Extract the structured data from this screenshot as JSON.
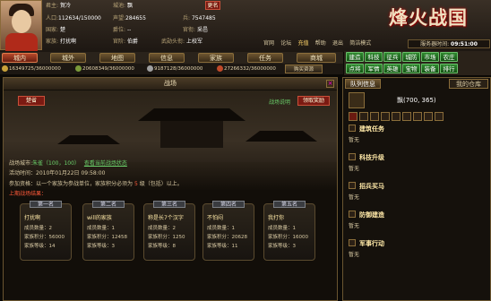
{
  "player": {
    "lord_label": "君主:",
    "lord_name": "賀冷",
    "city_label": "城池:",
    "city_name": "飘",
    "rename_button": "更名",
    "population_label": "人口:",
    "population": "112634/150000",
    "prestige_label": "声望:",
    "prestige": "284655",
    "official_label": "兵:",
    "official": "7547485",
    "country_label": "国家:",
    "country": "楚",
    "rank_label": "爵位:",
    "rank": "--",
    "level_label": "官衔:",
    "level": "采邑",
    "family_label": "家族:",
    "family": "打扰啊",
    "office_label": "官阶:",
    "office": "伯爵",
    "arms_label": "武勋头衔:",
    "arms": "上校军"
  },
  "game_logo": "烽火战国",
  "top_links": [
    "官网",
    "论坛",
    "充值",
    "帮助",
    "退出",
    "简洁模式"
  ],
  "server_time": {
    "label": "服务器时间:",
    "value": "09:51:00"
  },
  "nav_tabs": [
    "城内",
    "城外",
    "地图",
    "信息",
    "家族",
    "任务",
    "商城"
  ],
  "resources": [
    {
      "value": "16349725/36000000",
      "color": "#c9a23a"
    },
    {
      "value": "20608349/36000000",
      "color": "#7a9a3a"
    },
    {
      "value": "9187128/36000000",
      "color": "#a0a0a0"
    },
    {
      "value": "27266332/36000000",
      "color": "#c04a2a"
    }
  ],
  "buy_resources": "购买资源",
  "menu_row1": [
    "建造",
    "科技",
    "征兵",
    "城防",
    "市场",
    "农庄"
  ],
  "menu_row2": [
    "点将",
    "军情",
    "英雄",
    "宝物",
    "装备",
    "排行"
  ],
  "battle": {
    "panel_title": "战场",
    "country_badge": "楚省",
    "battle_help": "战场说明",
    "claim_button": "领取奖励",
    "city_label": "战场城市:",
    "city_value": "朱雀（100，100）",
    "city_link": "查看当前战场状态",
    "time_label": "活动时间：",
    "time_value": "2010年01月22日 09:58:00",
    "qualify_label": "参加资格：",
    "qualify_value": "以一个家族为参战单位，家族积分必须为",
    "qualify_num": "5",
    "qualify_tail": "级（包括）以上。",
    "result_title": "上期战场结果：",
    "cards": [
      {
        "rank": "第一名",
        "name": "打扰啊",
        "members": "成员数量：2",
        "score": "家族积分：56000",
        "level": "家族等级：14"
      },
      {
        "rank": "第二名",
        "name": "will的家族",
        "members": "成员数量：1",
        "score": "家族积分：12458",
        "level": "家族等级：3"
      },
      {
        "rank": "第三名",
        "name": "称是长7个汉字",
        "members": "成员数量：2",
        "score": "家族积分：1250",
        "level": "家族等级：8"
      },
      {
        "rank": "第四名",
        "name": "不怕闷",
        "members": "成员数量：1",
        "score": "家族积分：20628",
        "level": "家族等级：11"
      },
      {
        "rank": "第五名",
        "name": "我打你",
        "members": "成员数量：1",
        "score": "家族积分：16000",
        "level": "家族等级：3"
      }
    ]
  },
  "side": {
    "tab_army": "队列信息",
    "tab_warehouse": "我的仓库",
    "city_title": "飘(700, 365)",
    "skills": [
      {
        "title": "建筑任务",
        "desc": "暂无"
      },
      {
        "title": "科技升级",
        "desc": "暂无"
      },
      {
        "title": "招兵买马",
        "desc": "暂无"
      },
      {
        "title": "防御建造",
        "desc": "暂无"
      },
      {
        "title": "军事行动",
        "desc": "暂无"
      }
    ]
  }
}
